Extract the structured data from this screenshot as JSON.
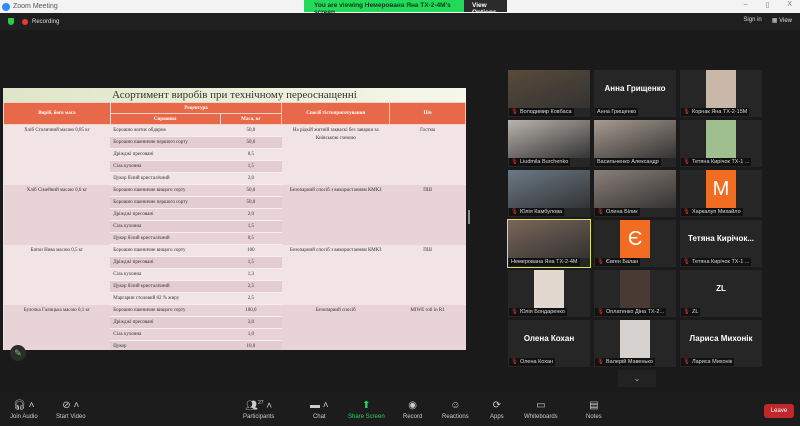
{
  "window": {
    "title": "Zoom Meeting",
    "minimize": "–",
    "maximize": "▯",
    "close": "X"
  },
  "banner": {
    "message": "You are viewing Немерована Яна ТХ-2-4М's screen",
    "view_options": "View Options ⌄"
  },
  "topbar": {
    "recording": "Recording",
    "sign_in": "Sign in",
    "view": "▦ View"
  },
  "slide": {
    "title": "Асортимент виробів при технічному переоснащенні",
    "headers": {
      "product": "Виріб, його маса",
      "recipe": "Рецептура",
      "raw": "Сировина",
      "mass": "Маса, кг",
      "method": "Спосіб тістоприготування",
      "oven": "Піч"
    },
    "products": [
      {
        "name": "Хліб Столичний масою 0,85 кг",
        "method": "На рідкій житній закваскі без заварки за Київською схемою",
        "oven": "Гостма",
        "items": [
          [
            "Борошно житнє обдирне",
            "50,0"
          ],
          [
            "Борошно пшеничне першого сорту",
            "50,0"
          ],
          [
            "Дріжджі пресовані",
            "0,5"
          ],
          [
            "Сіль кухонна",
            "1,5"
          ],
          [
            "Цукор білий кристалічний",
            "3,0"
          ]
        ]
      },
      {
        "name": "Хліб Сімейний масою 0,6 кг",
        "method": "Безопарний спосіб з використанням КМКЗ",
        "oven": "ПШ",
        "items": [
          [
            "Борошно пшеничне вищого сорту",
            "50,0"
          ],
          [
            "Борошно пшеничне першого сорту",
            "50,0"
          ],
          [
            "Дріжджі пресовані",
            "2,0"
          ],
          [
            "Сіль кухонна",
            "1,5"
          ],
          [
            "Цукор білий кристалічний",
            "0,5"
          ]
        ]
      },
      {
        "name": "Батон Нива масою 0,5 кг",
        "method": "Безопарний спосіб з використанням КМКЗ",
        "oven": "ПШ",
        "items": [
          [
            "Борошно пшеничне вищого сорту",
            "100"
          ],
          [
            "Дріжджі пресовані",
            "1,5"
          ],
          [
            "Сіль кухонна",
            "1,3"
          ],
          [
            "Цукор білий кристалічний",
            "2,5"
          ],
          [
            "Маргарин столовий 82 % жиру",
            "2,5"
          ]
        ]
      },
      {
        "name": "Булочка Галицька масою 0,1 кг",
        "method": "Безопарний спосіб",
        "oven": "MIWE roll in R1",
        "items": [
          [
            "Борошно пшеничне вищого сорту",
            "100,0"
          ],
          [
            "Дріжджі пресовані",
            "3,0"
          ],
          [
            "Сіль кухонна",
            "1,0"
          ],
          [
            "Цукор",
            "10,0"
          ]
        ]
      }
    ]
  },
  "participants": [
    {
      "name": "Володимир Ковбаса",
      "type": "video",
      "bg": "#5a4a3a"
    },
    {
      "name": "Анна Грищенко",
      "type": "name",
      "display": "Анна Грищенко",
      "muted": false
    },
    {
      "name": "Корнак Яна ТХ-2-15М",
      "type": "avatar",
      "bg": "#c9b8a8"
    },
    {
      "name": "Liudmila Burchenko",
      "type": "video",
      "bg": "#b9b4ae"
    },
    {
      "name": "Васильченко Александр",
      "type": "video",
      "bg": "#a79c90",
      "muted": false
    },
    {
      "name": "Тетяна Кирічок ТХ-1 ...",
      "type": "avatar",
      "bg": "#9fbf8f"
    },
    {
      "name": "Юлія Камбулова",
      "type": "video",
      "bg": "#6b7a86"
    },
    {
      "name": "Олена Білик",
      "type": "video",
      "bg": "#8a8078"
    },
    {
      "name": "Харкалуп Михайло",
      "type": "letter",
      "display": "M",
      "bg": "#f26d21"
    },
    {
      "name": "Немерована Яна ТХ-2-4М",
      "type": "video",
      "bg": "#7a6658",
      "muted": false,
      "speaking": true
    },
    {
      "name": "Євген Балан",
      "type": "letter",
      "display": "Є",
      "bg": "#f26d21"
    },
    {
      "name": "Тетяна Кирічок ТХ-1 ...",
      "type": "name",
      "display": "Тетяна Кирічок..."
    },
    {
      "name": "Юлія Бондаренко",
      "type": "avatar",
      "bg": "#e2d8cf"
    },
    {
      "name": "Оплатенко Діна ТХ-2...",
      "type": "avatar",
      "bg": "#4a3a34"
    },
    {
      "name": "ZL",
      "type": "name",
      "display": "ZL"
    },
    {
      "name": "Олена Кохан",
      "type": "name",
      "display": "Олена Кохан"
    },
    {
      "name": "Валерій Мавенько",
      "type": "avatar",
      "bg": "#d6d2cf"
    },
    {
      "name": "Лариса Михонік",
      "type": "name",
      "display": "Лариса Михонік"
    }
  ],
  "gallery": {
    "next_page": "⌄"
  },
  "toolbar": {
    "join_audio": "Join Audio",
    "start_video": "Start Video",
    "participants": "Participants",
    "participants_count": "27",
    "chat": "Chat",
    "share": "Share Screen",
    "record": "Record",
    "reactions": "Reactions",
    "apps": "Apps",
    "whiteboards": "Whiteboards",
    "notes": "Notes",
    "leave": "Leave"
  }
}
